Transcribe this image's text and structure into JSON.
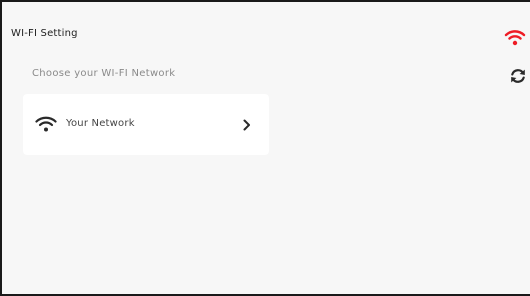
{
  "header": {
    "title": "WI-FI Setting",
    "status_icon": "wifi-icon",
    "status_color": "#ee1c25"
  },
  "networks": {
    "subtitle": "Choose your WI-FI Network",
    "refresh_icon": "refresh-icon",
    "items": [
      {
        "label": "Your Network",
        "icon": "wifi-icon",
        "action_icon": "chevron-right-icon"
      }
    ]
  },
  "colors": {
    "background": "#f7f7f7",
    "card": "#ffffff",
    "text": "#222222",
    "muted_text": "#8a8a8a",
    "icon": "#2a2a2a"
  }
}
